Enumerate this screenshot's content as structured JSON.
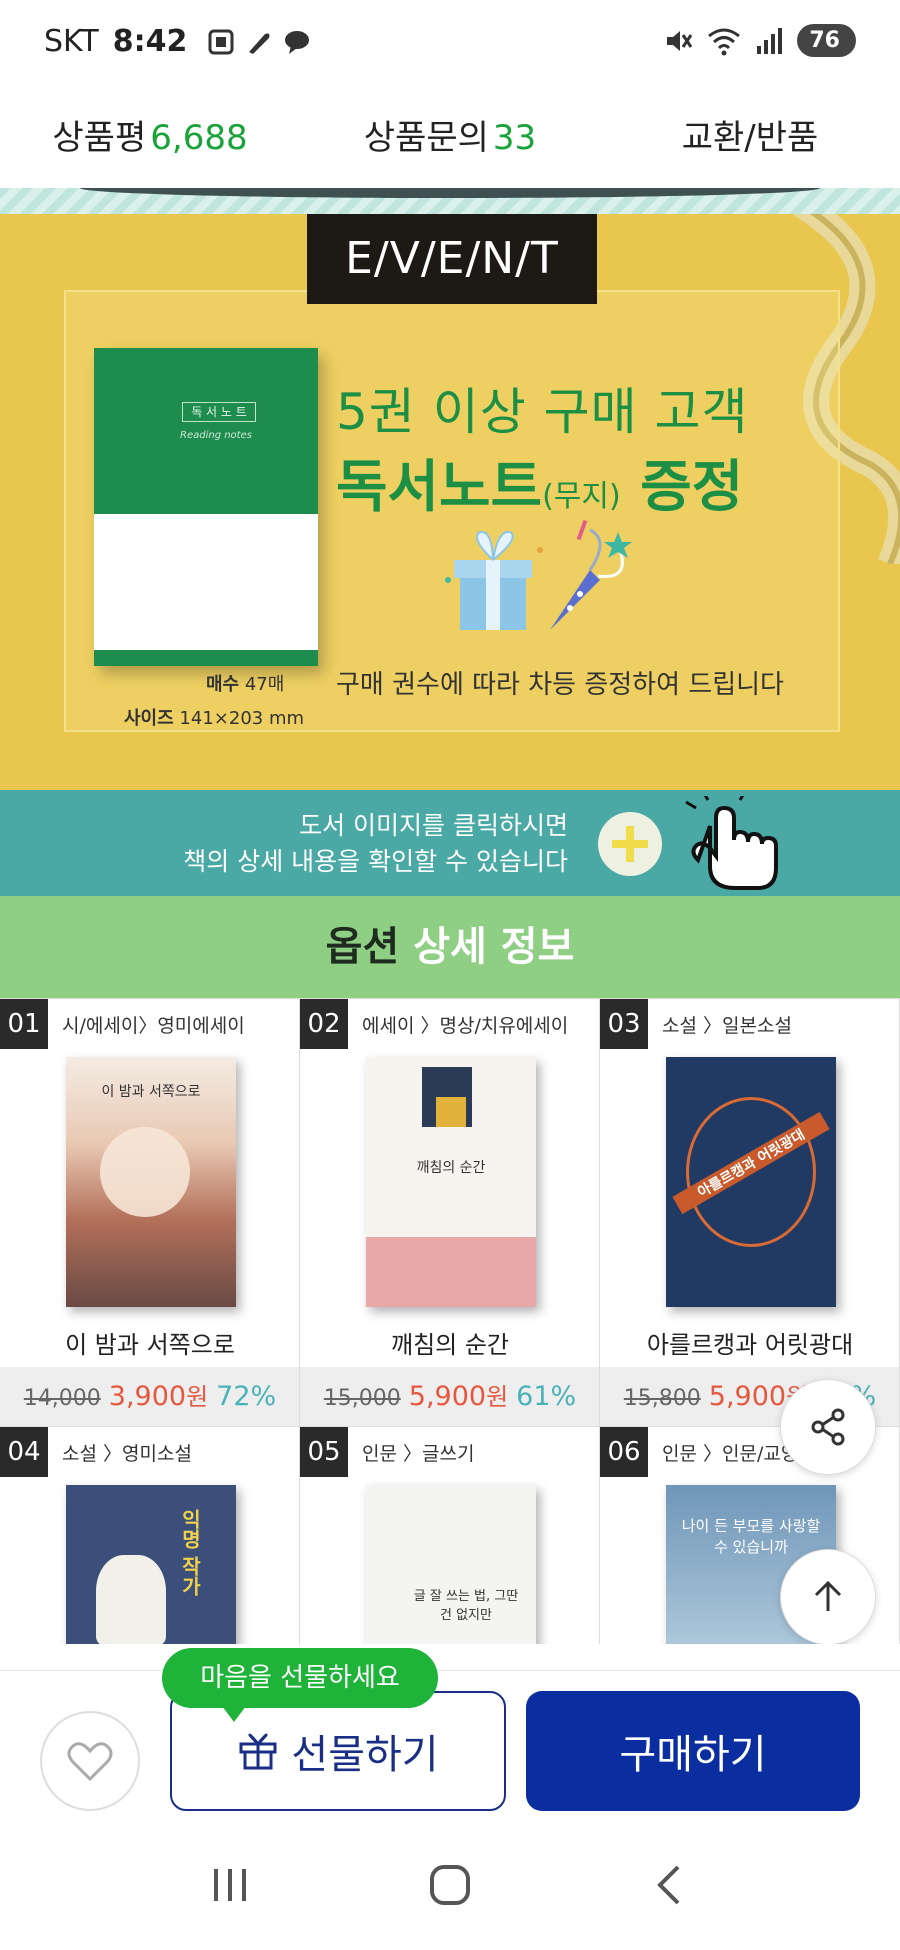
{
  "status_bar": {
    "carrier": "SKT",
    "time": "8:42",
    "battery": "76"
  },
  "tabs": [
    {
      "label": "상품평",
      "count": "6,688"
    },
    {
      "label": "상품문의",
      "count": "33"
    },
    {
      "label": "교환/반품",
      "count": ""
    }
  ],
  "event": {
    "tag": "E/V/E/N/T",
    "line1": "5권 이상 구매 고객",
    "line2_main": "독서노트",
    "line2_sub": "(무지)",
    "line2_end": " 증정",
    "notebook_title": "독 서 노 트",
    "notebook_subtitle": "Reading notes",
    "spec_pages_label": "매수",
    "spec_pages": "47매",
    "spec_size_label": "사이즈",
    "spec_size": "141×203 mm",
    "desc": "구매 권수에 따라 차등 증정하여 드립니다"
  },
  "hint": {
    "line1": "도서 이미지를 클릭하시면",
    "line2": "책의 상세 내용을 확인할 수 있습니다"
  },
  "options_header": {
    "part1": "옵션",
    "part2": " 상세 정보"
  },
  "books": [
    {
      "num": "01",
      "category": "시/에세이〉영미에세이",
      "title": "이 밤과 서쪽으로",
      "orig": "14,000",
      "sale": "3,900",
      "unit": "원",
      "discount": "72%",
      "cover_text": "이 밤과 서쪽으로",
      "color": "#c98b73"
    },
    {
      "num": "02",
      "category": "에세이 〉명상/치유에세이",
      "title": "깨침의 순간",
      "orig": "15,000",
      "sale": "5,900",
      "unit": "원",
      "discount": "61%",
      "cover_text": "깨침의 순간",
      "color": "#e9a8a8"
    },
    {
      "num": "03",
      "category": "소설 〉일본소설",
      "title": "아를르캥과 어릿광대",
      "orig": "15,800",
      "sale": "5,900",
      "unit": "원",
      "discount": "61%",
      "cover_text": "아를르캥과 어릿광대",
      "color": "#213a63"
    },
    {
      "num": "04",
      "category": "소설 〉영미소설",
      "title": "",
      "orig": "",
      "sale": "",
      "unit": "",
      "discount": "",
      "cover_text": "익명 작가",
      "color": "#3b4f7a"
    },
    {
      "num": "05",
      "category": "인문 〉글쓰기",
      "title": "",
      "orig": "",
      "sale": "",
      "unit": "",
      "discount": "",
      "cover_text": "글 잘 쓰는 법, 그딴 건 없지만",
      "color": "#f1f1f1"
    },
    {
      "num": "06",
      "category": "인문 〉인문/교양",
      "title": "",
      "orig": "",
      "sale": "",
      "unit": "",
      "discount": "",
      "cover_text": "나이 든 부모를 사랑할 수 있습니까",
      "color": "#6f96b8"
    }
  ],
  "bottom": {
    "tooltip": "마음을 선물하세요",
    "gift_label": "선물하기",
    "buy_label": "구매하기"
  },
  "colors": {
    "accent_green": "#1aa33a",
    "buy_blue": "#0a2ea0",
    "sale_red": "#e6573e",
    "discount_teal": "#4ab3b9"
  },
  "icons": [
    "screenshot-icon",
    "feather-icon",
    "chat-bubble-icon",
    "mute-icon",
    "wifi-icon",
    "signal-icon",
    "share-icon",
    "arrow-up-icon",
    "heart-icon",
    "gift-icon",
    "recent-apps-icon",
    "home-icon",
    "back-icon"
  ]
}
